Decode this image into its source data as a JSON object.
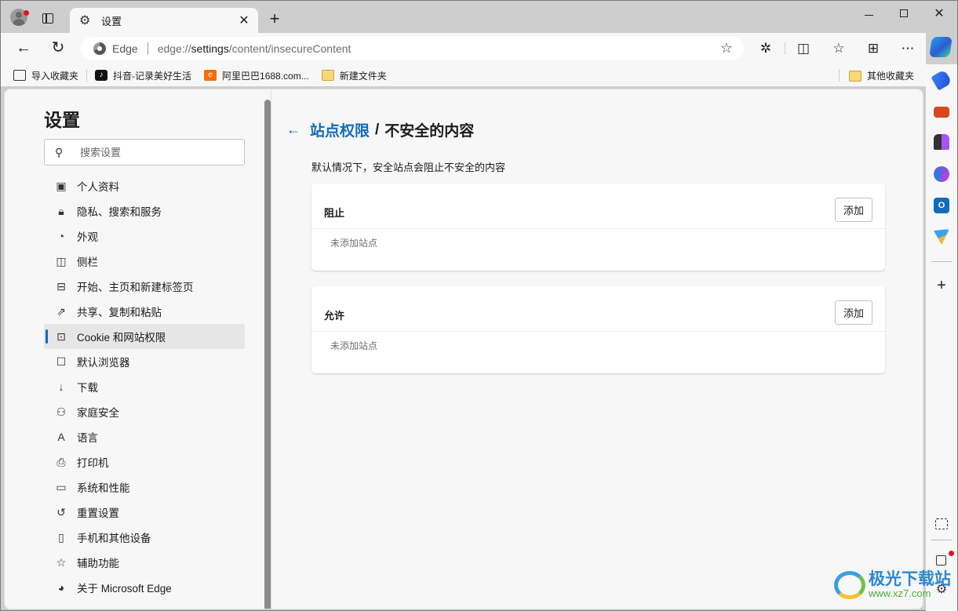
{
  "window": {
    "tab_title": "设置",
    "controls": {
      "minimize": "minimize",
      "maximize": "maximize",
      "close": "close"
    }
  },
  "toolbar": {
    "site_label": "Edge",
    "url_prefix": "edge://",
    "url_host": "settings",
    "url_path": "/content/insecureContent",
    "icons": [
      "back-icon",
      "reload-icon",
      "favorite-star-icon",
      "extensions-icon",
      "split-screen-icon",
      "favorites-icon",
      "collections-icon",
      "more-icon",
      "copilot-icon"
    ]
  },
  "bookmarks": {
    "items": [
      {
        "label": "导入收藏夹",
        "icon": "import-icon"
      },
      {
        "label": "抖音-记录美好生活",
        "icon": "tiktok-icon"
      },
      {
        "label": "阿里巴巴1688.com...",
        "icon": "alibaba-icon"
      },
      {
        "label": "新建文件夹",
        "icon": "folder-icon"
      }
    ],
    "other": "其他收藏夹"
  },
  "sidebar": {
    "title": "设置",
    "search_placeholder": "搜索设置",
    "items": [
      {
        "label": "个人资料",
        "icon": "profile-icon"
      },
      {
        "label": "隐私、搜索和服务",
        "icon": "lock-icon"
      },
      {
        "label": "外观",
        "icon": "palette-icon"
      },
      {
        "label": "侧栏",
        "icon": "sidebar-icon"
      },
      {
        "label": "开始、主页和新建标签页",
        "icon": "home-tab-icon"
      },
      {
        "label": "共享、复制和粘贴",
        "icon": "share-icon"
      },
      {
        "label": "Cookie 和网站权限",
        "icon": "cookie-permissions-icon",
        "active": true
      },
      {
        "label": "默认浏览器",
        "icon": "default-browser-icon"
      },
      {
        "label": "下载",
        "icon": "download-icon"
      },
      {
        "label": "家庭安全",
        "icon": "family-icon"
      },
      {
        "label": "语言",
        "icon": "language-icon"
      },
      {
        "label": "打印机",
        "icon": "printer-icon"
      },
      {
        "label": "系统和性能",
        "icon": "laptop-icon"
      },
      {
        "label": "重置设置",
        "icon": "reset-icon"
      },
      {
        "label": "手机和其他设备",
        "icon": "phone-icon"
      },
      {
        "label": "辅助功能",
        "icon": "accessibility-icon"
      },
      {
        "label": "关于 Microsoft Edge",
        "icon": "edge-logo-icon"
      }
    ]
  },
  "main": {
    "breadcrumb_parent": "站点权限",
    "breadcrumb_sep": "/",
    "breadcrumb_current": "不安全的内容",
    "description": "默认情况下，安全站点会阻止不安全的内容",
    "sections": [
      {
        "title": "阻止",
        "add_label": "添加",
        "empty_text": "未添加站点"
      },
      {
        "title": "允许",
        "add_label": "添加",
        "empty_text": "未添加站点"
      }
    ]
  },
  "rail": {
    "icons": [
      "shopping-tag-icon",
      "toolbox-icon",
      "games-icon",
      "m365-icon",
      "outlook-icon",
      "send-icon",
      "add-icon",
      "screenshot-icon",
      "open-external-icon",
      "settings-icon"
    ]
  },
  "watermark": {
    "name": "极光下载站",
    "url": "www.xz7.com"
  },
  "colors": {
    "accent": "#0f6cbd",
    "notification_dot": "#e81123"
  }
}
